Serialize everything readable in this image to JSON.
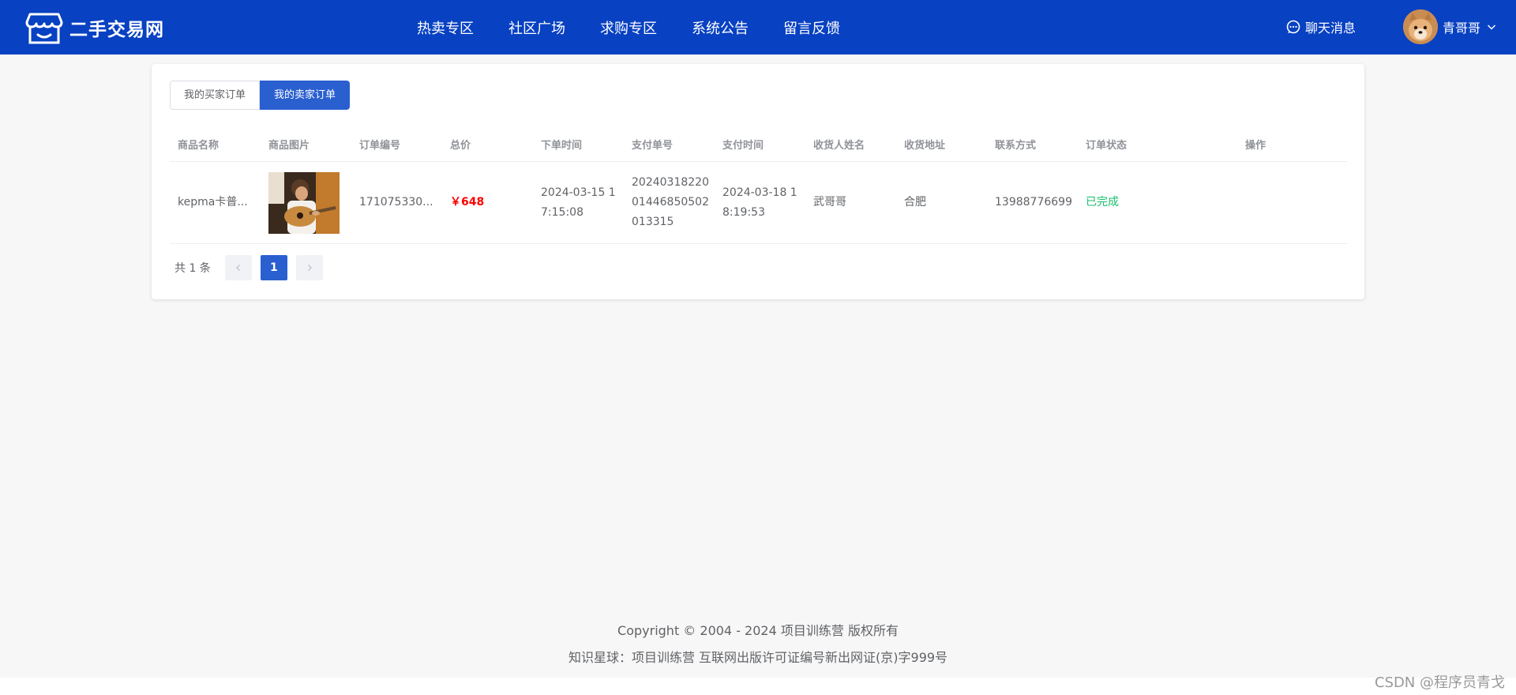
{
  "header": {
    "site_name": "二手交易网",
    "nav": [
      "热卖专区",
      "社区广场",
      "求购专区",
      "系统公告",
      "留言反馈"
    ],
    "chat_label": "聊天消息",
    "username": "青哥哥"
  },
  "tabs": {
    "buyer": "我的买家订单",
    "seller": "我的卖家订单",
    "active": "seller"
  },
  "table": {
    "columns": [
      "商品名称",
      "商品图片",
      "订单编号",
      "总价",
      "下单时间",
      "支付单号",
      "支付时间",
      "收货人姓名",
      "收货地址",
      "联系方式",
      "订单状态",
      "操作"
    ],
    "rows": [
      {
        "name": "kepma卡普...",
        "order_no": "171075330...",
        "price": "￥648",
        "order_time": "2024-03-15 17:15:08",
        "pay_no": "20240318220014468505 02013315",
        "pay_no_lines": [
          "20240318220",
          "01446850502",
          "013315"
        ],
        "order_time_lines": [
          "2024-03-15 1",
          "7:15:08"
        ],
        "pay_time_lines": [
          "2024-03-18 1",
          "8:19:53"
        ],
        "receiver": "武哥哥",
        "address": "合肥",
        "phone": "13988776699",
        "status": "已完成"
      }
    ]
  },
  "pagination": {
    "total": "共 1 条",
    "current": "1"
  },
  "footer": {
    "line1": "Copyright © 2004 - 2024 项目训练营 版权所有",
    "line2": "知识星球：项目训练营 互联网出版许可证编号新出网证(京)字999号"
  },
  "watermark": "CSDN @程序员青戈",
  "colors": {
    "header_bg": "#0841c2",
    "primary": "#2a5fd0",
    "price": "#ff0000",
    "status_done": "#19be6b"
  }
}
